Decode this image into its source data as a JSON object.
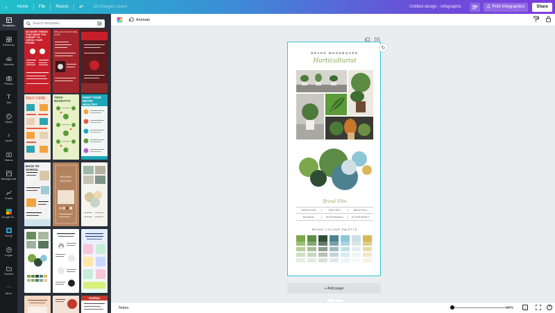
{
  "topbar": {
    "home_label": "Home",
    "file_label": "File",
    "resize_label": "Resize",
    "changes_label": "All changes saved",
    "doc_title": "Untitled design - Infographic",
    "print_label": "Print Infographics",
    "share_label": "Share"
  },
  "rail": {
    "items": [
      {
        "label": "Templates",
        "icon": "template-icon"
      },
      {
        "label": "Elements",
        "icon": "shapes-icon"
      },
      {
        "label": "Uploads",
        "icon": "cloud-upload-icon"
      },
      {
        "label": "Photos",
        "icon": "camera-icon"
      },
      {
        "label": "Text",
        "icon": "text-icon"
      },
      {
        "label": "Styles",
        "icon": "palette-icon"
      },
      {
        "label": "Audio",
        "icon": "music-icon"
      },
      {
        "label": "Videos",
        "icon": "video-icon"
      },
      {
        "label": "Background",
        "icon": "background-icon"
      },
      {
        "label": "Charts",
        "icon": "chart-icon"
      },
      {
        "label": "Google M...",
        "icon": "google-maps-icon"
      },
      {
        "label": "Emoji",
        "icon": "emoji-icon"
      },
      {
        "label": "Logos",
        "icon": "logo-icon"
      },
      {
        "label": "Folders",
        "icon": "folder-icon"
      },
      {
        "label": "More",
        "icon": "more-icon"
      }
    ]
  },
  "panel": {
    "search_placeholder": "Search templates",
    "templates": [
      {
        "title": "DO MORE THINGS THAT MAKE YOU FORGET TO CHECK YOUR PHONE",
        "color": "#c8202a"
      },
      {
        "title": "Why you should stay home",
        "color": "#a5252c"
      },
      {
        "title": "",
        "color": "#5e1a1c"
      },
      {
        "title": "SELF CARE",
        "color": "#f4ece1"
      },
      {
        "title": "TREE BENEFITS",
        "color": "#e9f1c9"
      },
      {
        "title": "KEEP YOUR BRAIN HEALTHY",
        "color": "#1aa7b8"
      },
      {
        "title": "BACK TO SCHOOL",
        "color": "#f3f3f3"
      },
      {
        "title": "BRAND BOARD",
        "color": "#b3825f"
      },
      {
        "title": "",
        "color": "#f5f5f0"
      },
      {
        "title": "",
        "color": "#ffffff"
      },
      {
        "title": "",
        "color": "#ffffff"
      },
      {
        "title": "",
        "color": "#eaf5ff"
      },
      {
        "title": "",
        "color": "#f4d9c4"
      },
      {
        "title": "",
        "color": "#f3e2d6"
      },
      {
        "title": "Gurkan",
        "color": "#ffffff"
      }
    ]
  },
  "canvas": {
    "animate_label": "Animate",
    "add_page_label": "+ Add page"
  },
  "design": {
    "header": "BRAND MOODBOARD",
    "title": "Horticulturist",
    "vibe_title": "Brand Vibe",
    "vibe_words": [
      "EARTHLING",
      "NEUTRAL",
      "BEAUTIFUL",
      "NATURAL",
      "SUSTAINABLE",
      "ECOFRIENDLY"
    ],
    "palette_title": "BRAND COLOUR PALETTE",
    "palette": [
      "#7aa84a",
      "#5c8c46",
      "#2f4d33",
      "#4c8290",
      "#8dc7d6",
      "#cfdfe3",
      "#d9b85c"
    ],
    "circles": [
      "#7aa84a",
      "#5c8c46",
      "#2f4d33",
      "#4c8290",
      "#8dc7d6",
      "#cfdfe3",
      "#d9b85c"
    ]
  },
  "bottombar": {
    "notes_label": "Notes",
    "zoom_label": "44%"
  },
  "colors": {
    "accent": "#2dc6d0",
    "rail_bg": "#18191b",
    "panel_bg": "#293039"
  }
}
